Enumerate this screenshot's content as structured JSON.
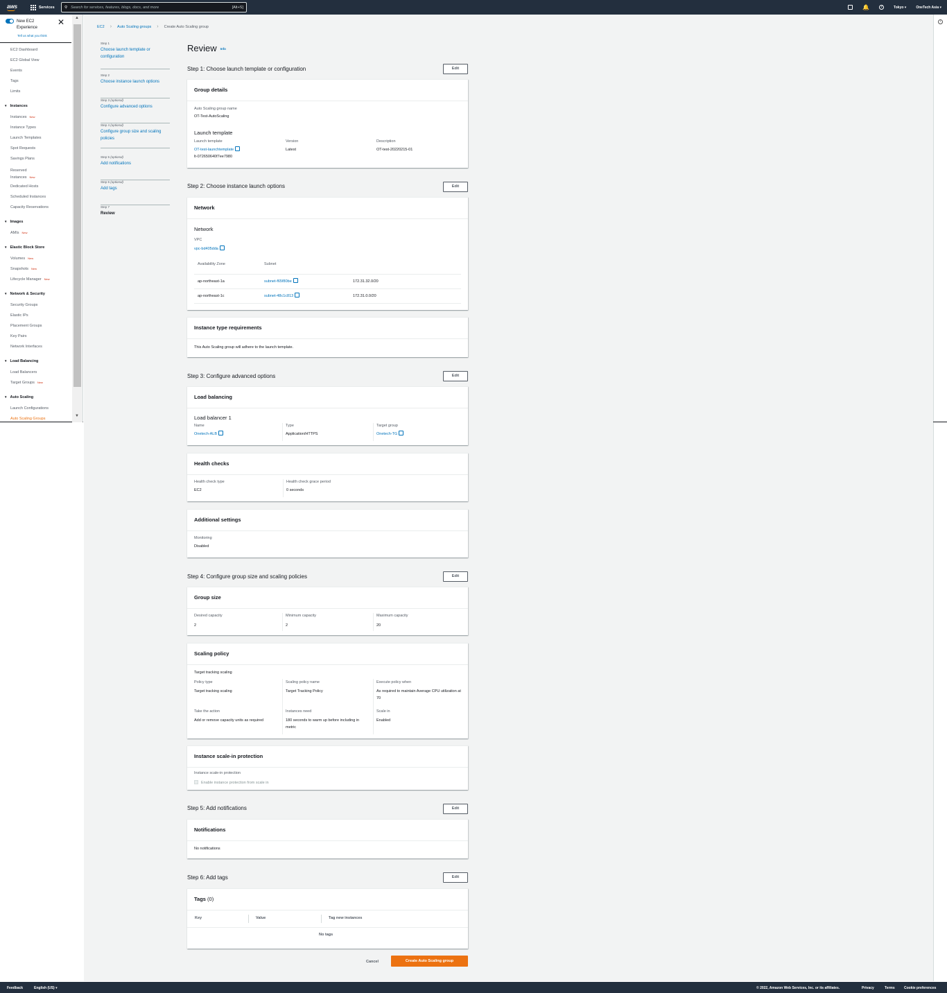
{
  "topbar": {
    "logo": "aws",
    "services_label": "Services",
    "search_placeholder": "Search for services, features, blogs, docs, and more",
    "search_shortcut": "[Alt+S]",
    "region": "Tokyo ▾",
    "account": "OneTech Asia ▾",
    "icons": [
      "cloudshell-icon",
      "bell-icon",
      "help-icon"
    ]
  },
  "sidebar": {
    "new_experience_title": "New EC2 Experience",
    "new_experience_link": "Tell us what you think",
    "top_items": [
      "EC2 Dashboard",
      "EC2 Global View",
      "Events",
      "Tags",
      "Limits"
    ],
    "new_badge": "New",
    "sections": [
      {
        "title": "Instances",
        "items": [
          {
            "label": "Instances",
            "new": true
          },
          {
            "label": "Instance Types"
          },
          {
            "label": "Launch Templates"
          },
          {
            "label": "Spot Requests"
          },
          {
            "label": "Savings Plans"
          },
          {
            "label": "Reserved",
            "label2": "Instances",
            "new": true
          },
          {
            "label": "Dedicated Hosts"
          },
          {
            "label": "Scheduled Instances"
          },
          {
            "label": "Capacity Reservations"
          }
        ]
      },
      {
        "title": "Images",
        "items": [
          {
            "label": "AMIs",
            "new": true
          }
        ]
      },
      {
        "title": "Elastic Block Store",
        "items": [
          {
            "label": "Volumes",
            "new": true
          },
          {
            "label": "Snapshots",
            "new": true
          },
          {
            "label": "Lifecycle Manager",
            "new": true
          }
        ]
      },
      {
        "title": "Network & Security",
        "items": [
          {
            "label": "Security Groups"
          },
          {
            "label": "Elastic IPs"
          },
          {
            "label": "Placement Groups"
          },
          {
            "label": "Key Pairs"
          },
          {
            "label": "Network Interfaces"
          }
        ]
      },
      {
        "title": "Load Balancing",
        "items": [
          {
            "label": "Load Balancers"
          },
          {
            "label": "Target Groups",
            "new": true
          }
        ]
      },
      {
        "title": "Auto Scaling",
        "items": [
          {
            "label": "Launch Configurations"
          },
          {
            "label": "Auto Scaling Groups",
            "active": true
          }
        ]
      }
    ]
  },
  "breadcrumb": [
    "EC2",
    "Auto Scaling groups",
    "Create Auto Scaling group"
  ],
  "wizard": {
    "optional": "(optional)",
    "steps": [
      {
        "num": "Step 1",
        "label": "Choose launch template or configuration",
        "optional": false
      },
      {
        "num": "Step 2",
        "label": "Choose instance launch options",
        "optional": false
      },
      {
        "num": "Step 3",
        "label": "Configure advanced options",
        "optional": true
      },
      {
        "num": "Step 4",
        "label": "Configure group size and scaling policies",
        "optional": true
      },
      {
        "num": "Step 5",
        "label": "Add notifications",
        "optional": true
      },
      {
        "num": "Step 6",
        "label": "Add tags",
        "optional": true
      },
      {
        "num": "Step 7",
        "label": "Review",
        "optional": false,
        "current": true
      }
    ]
  },
  "page": {
    "title": "Review",
    "info": "Info",
    "edit_label": "Edit"
  },
  "step1": {
    "heading": "Step 1: Choose launch template or configuration",
    "card_title": "Group details",
    "name_label": "Auto Scaling group name",
    "name_value": "OT-Test-AutoScaling",
    "lt_heading": "Launch template",
    "lt_label": "Launch template",
    "lt_value": "OT-test-launchtemplate",
    "lt_id": "lt-072650640f7ee7980",
    "version_label": "Version",
    "version_value": "Latest",
    "desc_label": "Description",
    "desc_value": "OT-test-20220215-01"
  },
  "step2": {
    "heading": "Step 2: Choose instance launch options",
    "card_title": "Network",
    "sub": "Network",
    "vpc_label": "VPC",
    "vpc_value": "vpc-bd405dda",
    "az_header": "Availability Zone",
    "subnet_header": "Subnet",
    "rows": [
      {
        "az": "ap-northeast-1a",
        "subnet": "subnet-f65f80be",
        "cidr": "172.31.32.0/20"
      },
      {
        "az": "ap-northeast-1c",
        "subnet": "subnet-48c1c813",
        "cidr": "172.31.0.0/20"
      }
    ],
    "itr_title": "Instance type requirements",
    "itr_text": "This Auto Scaling group will adhere to the launch template."
  },
  "step3": {
    "heading": "Step 3: Configure advanced options",
    "lb_title": "Load balancing",
    "lb_sub": "Load balancer 1",
    "lb_name_label": "Name",
    "lb_name_value": "Onetech-ALB",
    "lb_type_label": "Type",
    "lb_type_value": "Application/HTTPS",
    "lb_tg_label": "Target group",
    "lb_tg_value": "Onetech-TG",
    "hc_title": "Health checks",
    "hc_type_label": "Health check type",
    "hc_type_value": "EC2",
    "hc_grace_label": "Health check grace period",
    "hc_grace_value": "0 seconds",
    "as_title": "Additional settings",
    "mon_label": "Monitoring",
    "mon_value": "Disabled"
  },
  "step4": {
    "heading": "Step 4: Configure group size and scaling policies",
    "gs_title": "Group size",
    "desired_label": "Desired capacity",
    "desired_value": "2",
    "min_label": "Minimum capacity",
    "min_value": "2",
    "max_label": "Maximum capacity",
    "max_value": "20",
    "sp_title": "Scaling policy",
    "sp_sub": "Target tracking scaling",
    "pt_label": "Policy type",
    "pt_value": "Target tracking scaling",
    "spn_label": "Scaling policy name",
    "spn_value": "Target Tracking Policy",
    "epw_label": "Execute policy when",
    "epw_value": "As required to maintain Average CPU utilization at 70",
    "tta_label": "Take the action",
    "tta_value": "Add or remove capacity units as required",
    "in_label": "Instances need",
    "in_value": "180 seconds to warm up before including in metric",
    "si_label": "Scale in",
    "si_value": "Enabled",
    "isp_title": "Instance scale-in protection",
    "isp_label": "Instance scale-in protection",
    "isp_checkbox": "Enable instance protection from scale in"
  },
  "step5": {
    "heading": "Step 5: Add notifications",
    "title": "Notifications",
    "text": "No notifications"
  },
  "step6": {
    "heading": "Step 6: Add tags",
    "title": "Tags",
    "count": "(0)",
    "col_key": "Key",
    "col_value": "Value",
    "col_tni": "Tag new instances",
    "empty": "No tags"
  },
  "actions": {
    "cancel": "Cancel",
    "create": "Create Auto Scaling group"
  },
  "footer": {
    "feedback": "Feedback",
    "language": "English (US) ▾",
    "copyright": "© 2022, Amazon Web Services, Inc. or its affiliates.",
    "privacy": "Privacy",
    "terms": "Terms",
    "cookies": "Cookie preferences"
  }
}
